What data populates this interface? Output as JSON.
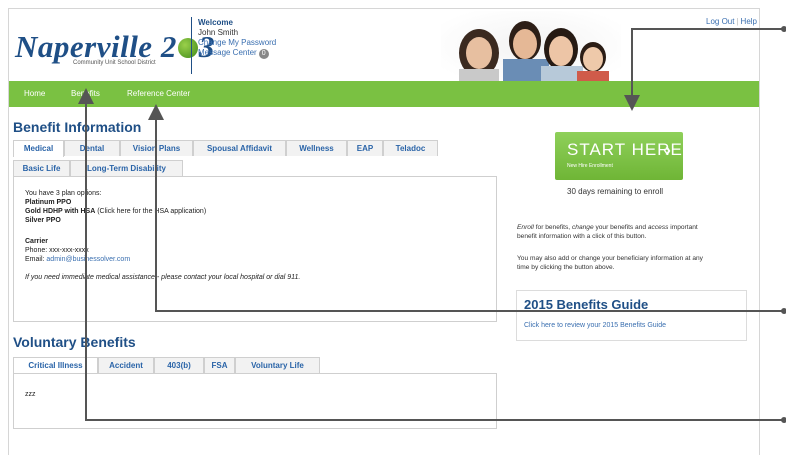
{
  "header": {
    "logo_text_1": "Naperville 2",
    "logo_text_2": "3",
    "logo_subtitle": "Community Unit School District",
    "welcome_title": "Welcome",
    "user_name": "John Smith",
    "change_password": "Change My Password",
    "message_center": "Message Center",
    "message_count": "0",
    "logout": "Log Out",
    "divider": "|",
    "help": "Help"
  },
  "nav": {
    "items": [
      "Home",
      "Benefits",
      "Reference Center"
    ]
  },
  "benefit_info": {
    "title": "Benefit Information",
    "tabs_row1": [
      "Medical",
      "Dental",
      "Vision Plans",
      "Spousal Affidavit",
      "Wellness",
      "EAP",
      "Teladoc"
    ],
    "tabs_row2": [
      "Basic Life",
      "Long-Term Disability"
    ],
    "intro": "You have 3 plan options:",
    "plan1": "Platinum PPO",
    "plan2": "Gold HDHP with HSA",
    "plan2_note": "(Click here for the HSA application)",
    "plan3": "Silver PPO",
    "carrier_label": "Carrier",
    "phone": "Phone: xxx-xxx-xxxx",
    "email_label": "Email: ",
    "email": "admin@businessolver.com",
    "emergency": "If you need immediate medical assistance - please contact your local hospital or dial 911."
  },
  "voluntary": {
    "title": "Voluntary Benefits",
    "tabs": [
      "Critical Illness",
      "Accident",
      "403(b)",
      "FSA",
      "Voluntary Life"
    ],
    "content": "zzz"
  },
  "right": {
    "start_label": "START HERE",
    "start_arrow": "›",
    "start_sub": "New Hire Enrollment",
    "days_remaining": "30 days remaining to enroll",
    "enroll_word": "Enroll",
    "enroll_mid1": " for benefits, ",
    "change_word": "change",
    "enroll_mid2": " your benefits and ",
    "access_word": "access",
    "enroll_end1": " important",
    "enroll_line2": "benefit information with a click of this button.",
    "beneficiary_line1": "You may also add or change your beneficiary information at any",
    "beneficiary_line2": "time by clicking the button above.",
    "guide_title": "2015 Benefits Guide",
    "guide_link": "Click here to review your 2015 Benefits Guide"
  },
  "colors": {
    "brand_blue": "#1f4f86",
    "nav_green": "#7ac142",
    "link_blue": "#3a6fb0",
    "callout_gray": "#555555"
  }
}
